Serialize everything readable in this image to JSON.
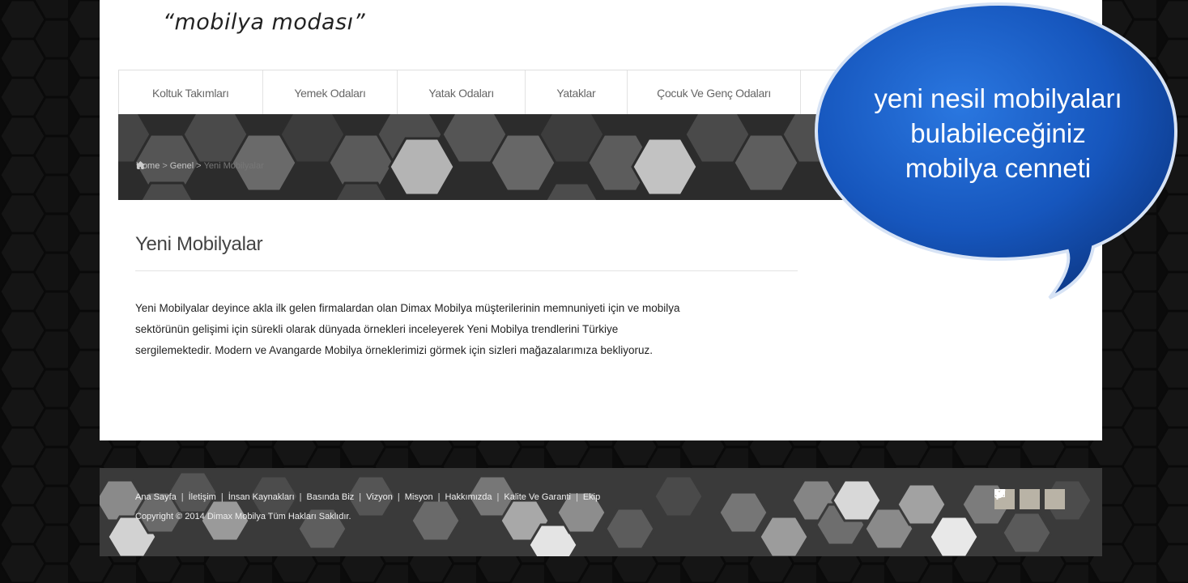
{
  "header": {
    "tagline": "“mobilya modası”"
  },
  "nav": {
    "items": [
      {
        "label": "Koltuk Takımları"
      },
      {
        "label": "Yemek Odaları"
      },
      {
        "label": "Yatak Odaları"
      },
      {
        "label": "Yataklar"
      },
      {
        "label": "Çocuk Ve Genç Odaları"
      }
    ]
  },
  "breadcrumb": {
    "home": "Home",
    "category": "Genel",
    "current": "Yeni Mobilyalar",
    "separator": ">"
  },
  "content": {
    "title": "Yeni Mobilyalar",
    "lines": [
      "Yeni Mobilyalar deyince akla ilk gelen firmalardan olan Dimax Mobilya müşterilerinin memnuniyeti için ve mobilya",
      "sektörünün gelişimi için sürekli olarak dünyada örnekleri inceleyerek Yeni Mobilya trendlerini Türkiye",
      "sergilemektedir. Modern ve Avangarde Mobilya örneklerimizi görmek için sizleri mağazalarımıza bekliyoruz."
    ]
  },
  "footer": {
    "links": [
      "Ana Sayfa",
      "İletişim",
      "İnsan Kaynakları",
      "Basında Biz",
      "Vizyon",
      "Misyon",
      "Hakkımızda",
      "Kalite Ve Garanti",
      "Ekip"
    ],
    "separator": "|",
    "copyright": "Copyright © 2014 Dimax Mobilya Tüm Hakları Saklıdır.",
    "social_icons": [
      "mail-icon",
      "twitter-icon",
      "facebook-icon"
    ]
  },
  "bubble": {
    "line1": "yeni nesil mobilyaları",
    "line2": "bulabileceğiniz",
    "line3": "mobilya cenneti"
  },
  "colors": {
    "page_bg": "#0b0b0b",
    "bubble": "#1a5bc4",
    "social_button": "#b9b3a6"
  }
}
